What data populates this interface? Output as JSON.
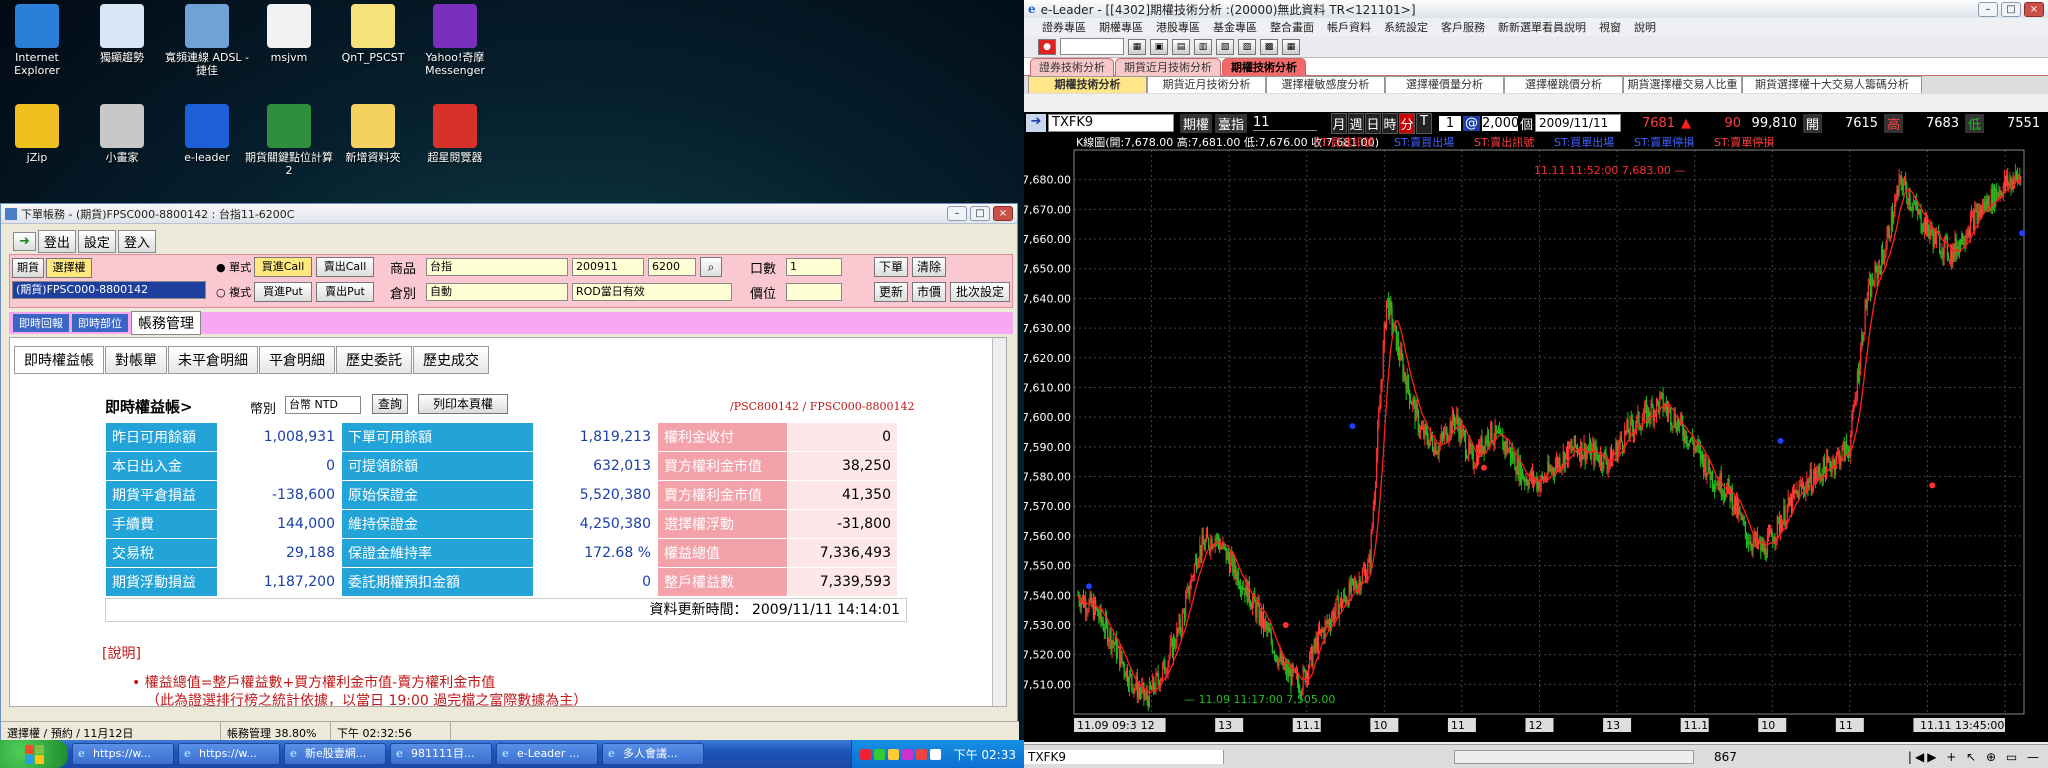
{
  "desktop": {
    "icons": [
      {
        "label": "Internet Explorer",
        "icon": "ie-icon",
        "color": "#2a7fd8"
      },
      {
        "label": "獨顯趨勢",
        "icon": "chart-app-icon",
        "color": "#d9e6f5"
      },
      {
        "label": "寬頻連線 ADSL - 捷佳",
        "icon": "network-icon",
        "color": "#6fa3d8"
      },
      {
        "label": "msjvm",
        "icon": "document-icon",
        "color": "#f2f2f2"
      },
      {
        "label": "QnT_PSCST",
        "icon": "notepad-icon",
        "color": "#f5e27a"
      },
      {
        "label": "Yahoo!奇摩 Messenger",
        "icon": "yahoo-icon",
        "color": "#7b2fbf"
      },
      {
        "label": "jZip",
        "icon": "zip-icon",
        "color": "#f0c020"
      },
      {
        "label": "小畫家",
        "icon": "paint-icon",
        "color": "#c8c8c8"
      },
      {
        "label": "e-leader",
        "icon": "eleader-icon",
        "color": "#1d5fd8"
      },
      {
        "label": "期貨關鍵點位計算2",
        "icon": "excel-icon",
        "color": "#2f8f3f"
      },
      {
        "label": "新增資料夾",
        "icon": "folder-icon",
        "color": "#f3d260"
      },
      {
        "label": "超星閱覽器",
        "icon": "reader-icon",
        "color": "#d8312a"
      }
    ]
  },
  "order_window": {
    "title": "下單帳務 - (期貨)FPSC000-8800142 : 台指11-6200C",
    "toolbar": {
      "logout": "登出",
      "settings": "設定",
      "login": "登入"
    },
    "mode_tabs": [
      "期貨",
      "選擇權"
    ],
    "account_select": "(期貨)FPSC000-8800142",
    "radio_single": "單式",
    "radio_multi": "複式",
    "buy_call": "買進Call",
    "sell_call": "賣出Call",
    "buy_put": "買進Put",
    "sell_put": "賣出Put",
    "product_label": "商品",
    "product_value": "台指",
    "month_value": "200911",
    "strike_value": "6200",
    "warehouse_label": "倉別",
    "warehouse_value": "自動",
    "rod_value": "ROD當日有效",
    "qty_label": "口數",
    "qty_value": "1",
    "price_label": "價位",
    "order_btn": "下單",
    "clear_btn": "清除",
    "update_btn": "更新",
    "market_btn": "市價",
    "batch_btn": "批次設定",
    "section_tabs": [
      "即時回報",
      "即時部位",
      "帳務管理"
    ],
    "sub_tabs": [
      "即時權益帳",
      "對帳單",
      "未平倉明細",
      "平倉明細",
      "歷史委託",
      "歷史成交"
    ],
    "equity_title": "即時權益帳>",
    "currency_label": "幣別",
    "currency_value": "台幣 NTD",
    "query_btn": "查詢",
    "print_btn": "列印本頁權",
    "account_code": "/PSC800142 / FPSC000-8800142",
    "rows": [
      [
        "昨日可用餘額",
        "1,008,931",
        "下單可用餘額",
        "1,819,213",
        "權利金收付",
        "0"
      ],
      [
        "本日出入金",
        "0",
        "可提領餘額",
        "632,013",
        "買方權利金市值",
        "38,250"
      ],
      [
        "期貨平倉損益",
        "-138,600",
        "原始保證金",
        "5,520,380",
        "賣方權利金市值",
        "41,350"
      ],
      [
        "手續費",
        "144,000",
        "維持保證金",
        "4,250,380",
        "選擇權浮動",
        "-31,800"
      ],
      [
        "交易稅",
        "29,188",
        "保證金維持率",
        "172.68 %",
        "權益總值",
        "7,336,493"
      ],
      [
        "期貨浮動損益",
        "1,187,200",
        "委託期權預扣金額",
        "0",
        "整戶權益數",
        "7,339,593"
      ]
    ],
    "updated": "資料更新時間： 2009/11/11 14:14:01",
    "note_title": "[說明]",
    "note_line1": "權益總值=整戶權益數+買方權利金市值-賣方權利金市值",
    "note_line2": "（此為證選排行榜之統計依據，以當日 19:00 過完檔之富際數據為主）",
    "status": [
      "選擇權 / 預約 / 11月12日",
      "帳務管理 38.80%",
      "下午 02:32:56"
    ]
  },
  "taskbar": {
    "tasks": [
      "https://w...",
      "https://w...",
      "新e股壹網...",
      "981111目...",
      "e-Leader ...",
      "多人會議..."
    ],
    "clock": "下午 02:33"
  },
  "right_app": {
    "title": "e-Leader - [[4302]期權技術分析 :(20000)無此資料  TR<121101>]",
    "menu": [
      "證券專區",
      "期權專區",
      "港股專區",
      "基金專區",
      "整合畫面",
      "帳戶資料",
      "系統設定",
      "客戶服務",
      "新新選單看員說明",
      "視窗",
      "說明"
    ],
    "page_tabs": [
      "證券技術分析",
      "期貨近月技術分析",
      "期權技術分析"
    ],
    "grid_tabs": [
      "期權技術分析",
      "期貨近月技術分析",
      "選擇權敏感度分析",
      "選擇權價量分析",
      "選擇權跳價分析",
      "期貨選擇權交易人比重",
      "期貨選擇權十大交易人籌碼分析"
    ],
    "quote": {
      "symbol": "TXFK9",
      "kind": "期權",
      "market": "臺指",
      "count": "11",
      "periods": [
        "月",
        "週",
        "日",
        "時",
        "分",
        "T"
      ],
      "interval": "1",
      "at": "@",
      "bars": "2,000",
      "bars_unit": "個",
      "date": "2009/11/11",
      "last": "7681",
      "arrow": "▲",
      "change": "90",
      "volume": "99,810",
      "open_label": "開",
      "open": "7615",
      "high_label": "高",
      "high": "7683",
      "low_label": "低",
      "low": "7551"
    },
    "chart_header": "K線圖(開:7,678.00 高:7,681.00 低:7,676.00 收:7,681.00)",
    "signals": [
      {
        "text": "ST:買進訊號",
        "color": "#ff4040"
      },
      {
        "text": "ST:賣買出場",
        "color": "#4060ff"
      },
      {
        "text": "ST:賣出訊號",
        "color": "#ff4040"
      },
      {
        "text": "ST:買單出場",
        "color": "#4060ff"
      },
      {
        "text": "ST:賣單停損",
        "color": "#4060ff"
      },
      {
        "text": "ST:賣單停損",
        "color": "#ff4040"
      }
    ],
    "high_annotation": "11.11 11:52:00  7,683.00 —",
    "low_annotation": "— 11.09 11:17:00  7,505.00",
    "x_labels": [
      "11.09 09:39:00",
      "12",
      "13",
      "11.10",
      "10",
      "11",
      "12",
      "13",
      "11.11",
      "10",
      "11",
      "12",
      "11.11 13:45:00"
    ],
    "status_symbol": "TXFK9",
    "status_count": "867"
  },
  "chart_data": {
    "type": "candlestick",
    "title": "K線圖(開:7,678.00 高:7,681.00 低:7,676.00 收:7,681.00)",
    "ylim": [
      7500,
      7690
    ],
    "yticks": [
      7510,
      7520,
      7530,
      7540,
      7550,
      7560,
      7570,
      7580,
      7590,
      7600,
      7610,
      7620,
      7630,
      7640,
      7650,
      7660,
      7670,
      7680
    ],
    "ytick_labels": [
      "7,510.00",
      "7,520.00",
      "7,530.00",
      "7,540.00",
      "7,550.00",
      "7,560.00",
      "7,570.00",
      "7,580.00",
      "7,590.00",
      "7,600.00",
      "7,610.00",
      "7,620.00",
      "7,630.00",
      "7,640.00",
      "7,650.00",
      "7,660.00",
      "7,670.00",
      "7,680.00"
    ],
    "price_path": [
      7540,
      7535,
      7525,
      7512,
      7505,
      7515,
      7530,
      7555,
      7560,
      7550,
      7540,
      7528,
      7515,
      7510,
      7525,
      7535,
      7542,
      7550,
      7640,
      7615,
      7595,
      7590,
      7600,
      7585,
      7595,
      7590,
      7580,
      7578,
      7585,
      7590,
      7588,
      7585,
      7595,
      7600,
      7605,
      7598,
      7590,
      7580,
      7575,
      7560,
      7555,
      7565,
      7575,
      7580,
      7585,
      7590,
      7640,
      7655,
      7680,
      7668,
      7660,
      7655,
      7665,
      7672,
      7678,
      7681
    ],
    "grid": true,
    "line_color": "#ff2020",
    "up_color": "#ff3030",
    "down_color": "#20c020"
  }
}
